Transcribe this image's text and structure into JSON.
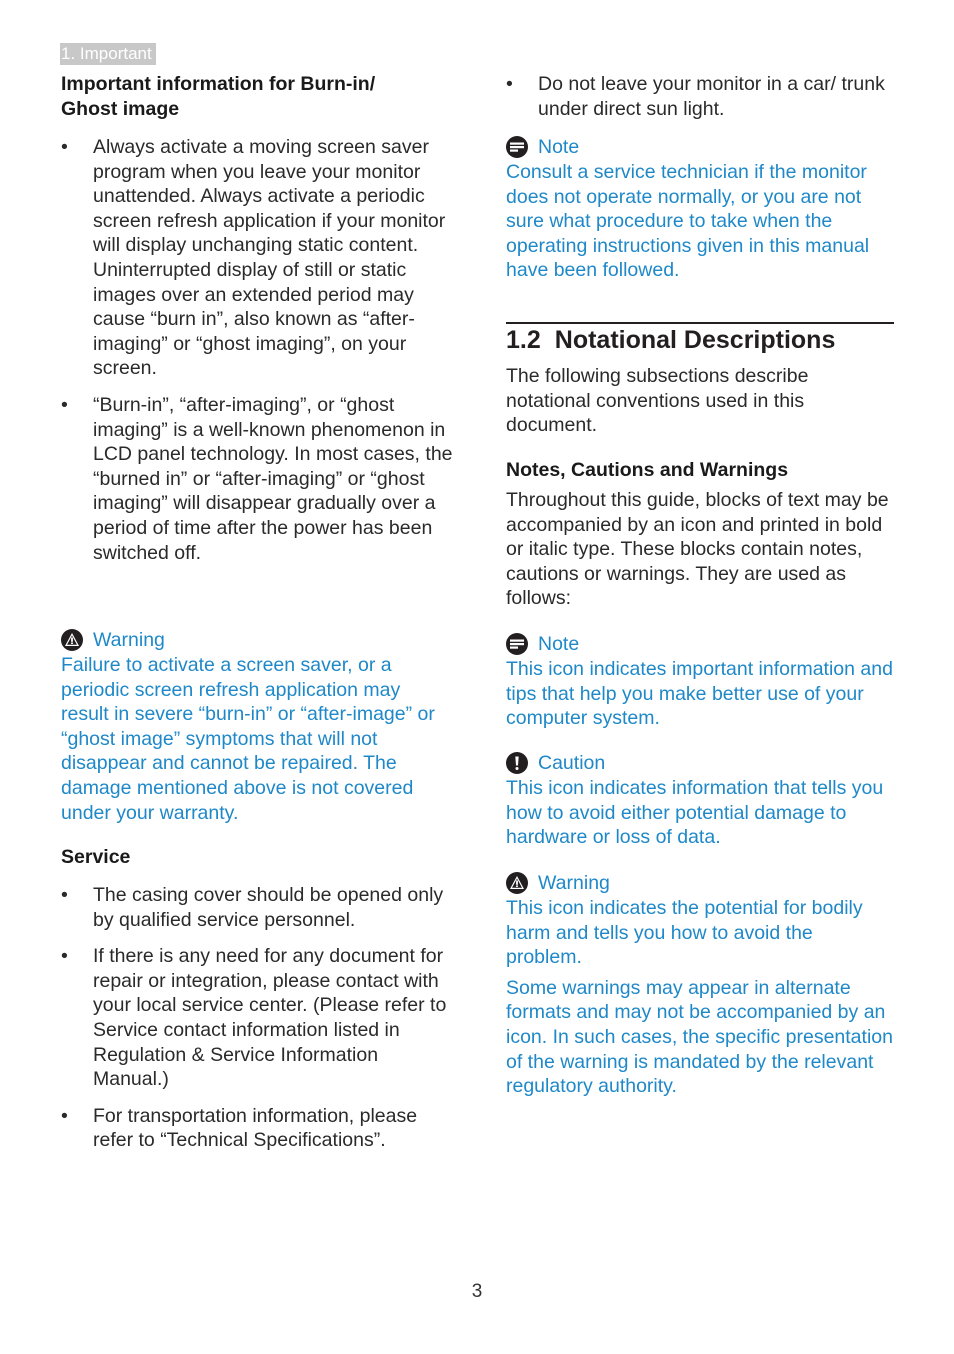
{
  "header": {
    "section_tag": "1. Important"
  },
  "left": {
    "burnin_heading": "Important information for Burn-in/ Ghost image",
    "burnin_bullets": [
      "Always activate a moving screen saver program when you leave your monitor unattended. Always activate a periodic screen refresh application if your monitor will display unchanging static content. Uninterrupted display of still or static images over an extended period may cause “burn in”, also known as “after-imaging” or “ghost imaging”, on your screen.",
      "“Burn-in”, “after-imaging”, or “ghost imaging” is a well-known phenomenon in LCD panel technology. In most cases, the “burned in” or “after-imaging” or “ghost imaging” will disappear gradually over a period of time after the power has been switched off."
    ],
    "warning": {
      "icon": "warning-triangle-icon",
      "title": "Warning",
      "text": "Failure to activate a screen saver, or a periodic screen refresh application may result in severe “burn-in” or “after-image” or “ghost image” symptoms that will not disappear and cannot be repaired. The damage mentioned above is not covered under your warranty."
    },
    "service_heading": "Service",
    "service_bullets": [
      "The casing cover should be opened only by qualified service personnel.",
      "If there is any need for any document for repair or integration, please contact with your local service center. (Please refer to Service contact information listed in Regulation & Service Information Manual.)",
      "For transportation information, please refer to “Technical Specifications”."
    ]
  },
  "right": {
    "top_bullets": [
      "Do not leave your monitor in a car/ trunk under direct sun light."
    ],
    "note": {
      "icon": "note-icon",
      "title": "Note",
      "text": "Consult a service technician if the monitor does not operate normally, or you are not sure what procedure to take when the operating instructions given in this manual have been followed."
    },
    "section": {
      "number": "1.2",
      "title": "Notational Descriptions",
      "intro": "The following subsections describe notational conventions used in this document."
    },
    "ncw_heading": "Notes, Cautions and Warnings",
    "ncw_intro": "Throughout this guide, blocks of text may be accompanied by an icon and printed in bold or italic type. These blocks contain notes, cautions or warnings. They are used as follows:",
    "callouts": [
      {
        "icon": "note-icon",
        "title": "Note",
        "text": "This icon indicates important information and tips that help you make better use of your computer system."
      },
      {
        "icon": "caution-icon",
        "title": "Caution",
        "text": "This icon indicates information that tells you how to avoid either potential damage to hardware or loss of data."
      },
      {
        "icon": "warning-triangle-icon",
        "title": "Warning",
        "text": "This icon indicates the potential for bodily harm and tells you how to avoid the problem."
      }
    ],
    "closing": "Some warnings may appear in alternate formats and may not be accompanied by an icon. In such cases, the specific presentation of the warning is mandated by the relevant regulatory authority."
  },
  "footer": {
    "page_number": "3"
  },
  "colors": {
    "accent": "#1e88c8",
    "text": "#231f20",
    "tag_bg": "#c8c8c8"
  }
}
